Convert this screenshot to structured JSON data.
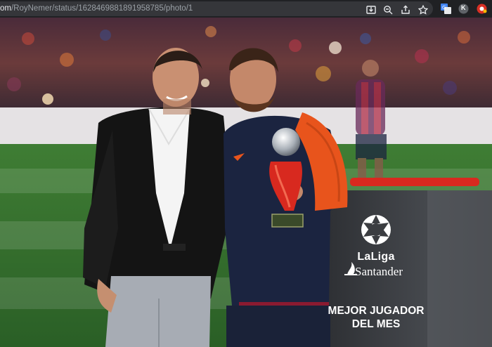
{
  "browser": {
    "url_prefix": "om",
    "url_rest": "/RoyNemer/status/1628469881891958785/photo/1",
    "profile_initial": "K",
    "toolbar_icons": [
      "install-app-icon",
      "zoom-icon",
      "share-icon",
      "bookmark-star-icon",
      "translate-icon",
      "profile-icon",
      "extension-icon"
    ]
  },
  "photo": {
    "sponsor_brand": "LaLiga",
    "sponsor_name": "Santander",
    "award_title_line1": "MEJOR JUGADOR",
    "award_title_line2": "DEL MES",
    "colors": {
      "pitch": "#2f6b2a",
      "jacket": "#141414",
      "jersey": "#1b2440",
      "trophy_red": "#d8291f",
      "orange_sleeve": "#e8541c",
      "podium": "#3b3d41"
    }
  }
}
